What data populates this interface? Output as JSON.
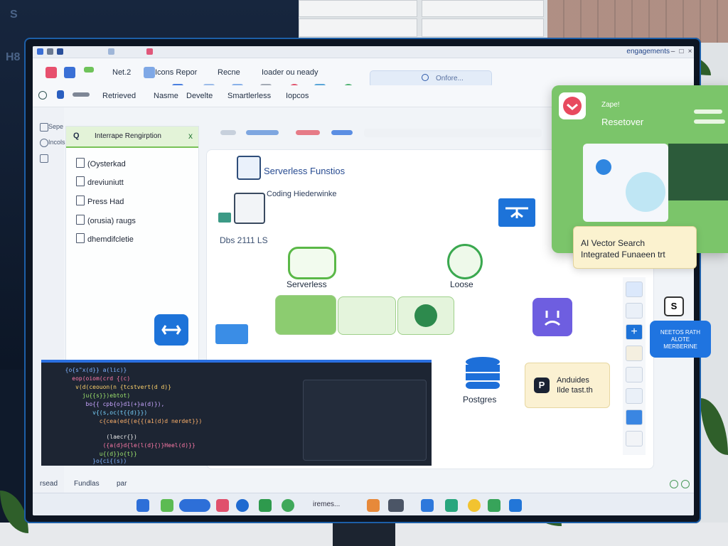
{
  "titlebar": {
    "right_text": "engagements"
  },
  "menu": {
    "items": [
      "Net.2",
      "Icons Repor",
      "Recne",
      "Ioader ou neady"
    ],
    "search_placeholder": "Onfore..."
  },
  "ribbon": {
    "items": [
      "Retrieved",
      "Nasme",
      "Develte",
      "Smartlerless",
      "Iopcos"
    ]
  },
  "left_rail": {
    "items": [
      "Sepe",
      "Incols"
    ]
  },
  "file_panel": {
    "header": "Interrape Rengirption",
    "close": "x",
    "items": [
      "(Oysterkad",
      "dreviuniutt",
      "Press Had",
      "(orusia) raugs",
      "dhemdifcletie"
    ]
  },
  "canvas": {
    "labels": {
      "serverless_functions": "Serverless Funstios",
      "hoading": "Coding Hiederwinke",
      "dbs": "Dbs 2111 LS",
      "serverless": "Serverless",
      "loose": "Loose",
      "postgres": "Postgres"
    }
  },
  "pg_card": {
    "line1": "Anduides",
    "line2": "Ilde tast.th"
  },
  "green_card": {
    "small": "Zape!",
    "title": "Resetover"
  },
  "yellow_card": {
    "line1": "AI Vector Search",
    "line2": "Integrated Funaeen trt"
  },
  "blue_card": {
    "text": "NEETOS RATH ALOTE MERBERINE"
  },
  "status": {
    "left": "rsead",
    "mid": "Fundlas",
    "right": "par"
  },
  "taskbar": {
    "center_text": "iremes..."
  },
  "colors": {
    "accent_blue": "#1d73d9",
    "accent_green": "#7bc56a",
    "editor_bg": "#1d2533"
  }
}
